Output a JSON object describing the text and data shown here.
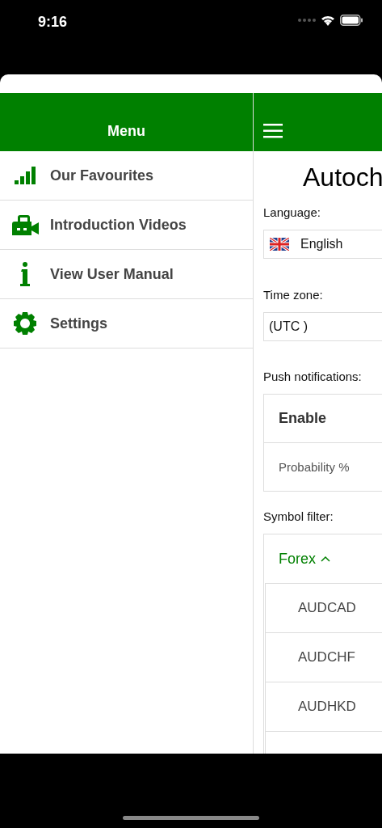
{
  "status_bar": {
    "time": "9:16"
  },
  "menu": {
    "title": "Menu",
    "items": [
      {
        "label": "Our Favourites",
        "kind": "bars"
      },
      {
        "label": "Introduction Videos",
        "kind": "video"
      },
      {
        "label": "View User Manual",
        "kind": "info"
      },
      {
        "label": "Settings",
        "kind": "gear"
      }
    ]
  },
  "settings": {
    "title": "Autoch",
    "language": {
      "label": "Language:",
      "value": "English"
    },
    "time_zone": {
      "label": "Time zone:",
      "value": "(UTC )"
    },
    "push": {
      "label": "Push notifications:",
      "enable": "Enable",
      "probability": "Probability %"
    },
    "symbol_filter": {
      "label": "Symbol filter:",
      "group": "Forex",
      "expanded": true,
      "symbols": [
        "AUDCAD",
        "AUDCHF",
        "AUDHKD"
      ]
    }
  }
}
